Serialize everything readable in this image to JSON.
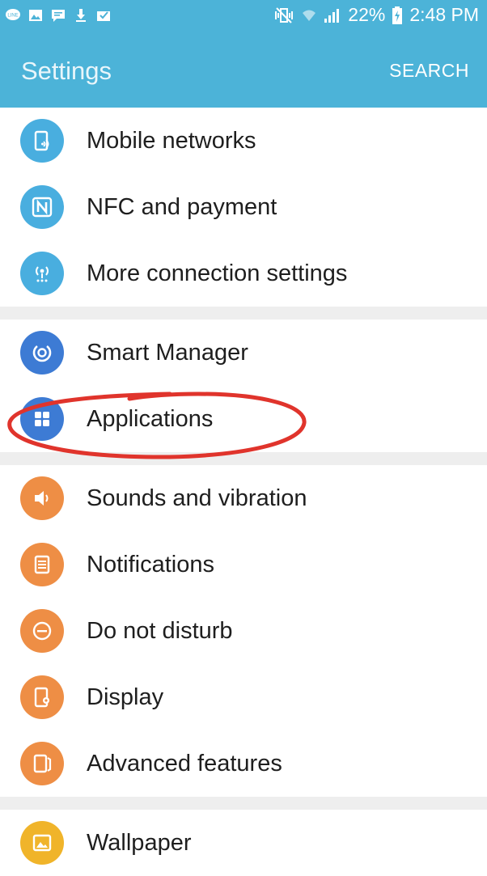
{
  "status_bar": {
    "left_icons": [
      "line-app-icon",
      "image-icon",
      "message-icon",
      "download-icon",
      "mail-check-icon"
    ],
    "right_icons": [
      "mute-vibrate-icon",
      "wifi-icon",
      "signal-icon",
      "battery-charging-icon"
    ],
    "battery": "22%",
    "time": "2:48 PM"
  },
  "app_bar": {
    "title": "Settings",
    "search_label": "SEARCH"
  },
  "groups": [
    {
      "items": [
        {
          "label": "Mobile networks",
          "icon": "mobile-network-icon",
          "color": "#49aedf"
        },
        {
          "label": "NFC and payment",
          "icon": "nfc-icon",
          "color": "#49aedf"
        },
        {
          "label": "More connection settings",
          "icon": "connection-antenna-icon",
          "color": "#49aedf"
        }
      ]
    },
    {
      "items": [
        {
          "label": "Smart Manager",
          "icon": "smart-manager-icon",
          "color": "#3d7bd4"
        },
        {
          "label": "Applications",
          "icon": "apps-grid-icon",
          "color": "#3d7bd4"
        }
      ]
    },
    {
      "items": [
        {
          "label": "Sounds and vibration",
          "icon": "speaker-icon",
          "color": "#ee8e45"
        },
        {
          "label": "Notifications",
          "icon": "notification-icon",
          "color": "#ee8e45"
        },
        {
          "label": "Do not disturb",
          "icon": "do-not-disturb-icon",
          "color": "#ee8e45"
        },
        {
          "label": "Display",
          "icon": "display-icon",
          "color": "#ee8e45"
        },
        {
          "label": "Advanced features",
          "icon": "advanced-features-icon",
          "color": "#ee8e45"
        }
      ]
    },
    {
      "items": [
        {
          "label": "Wallpaper",
          "icon": "wallpaper-icon",
          "color": "#f0b42a"
        }
      ]
    }
  ],
  "colors": {
    "app_bar": "#4cb3d8",
    "annotation": "#e0342c"
  }
}
